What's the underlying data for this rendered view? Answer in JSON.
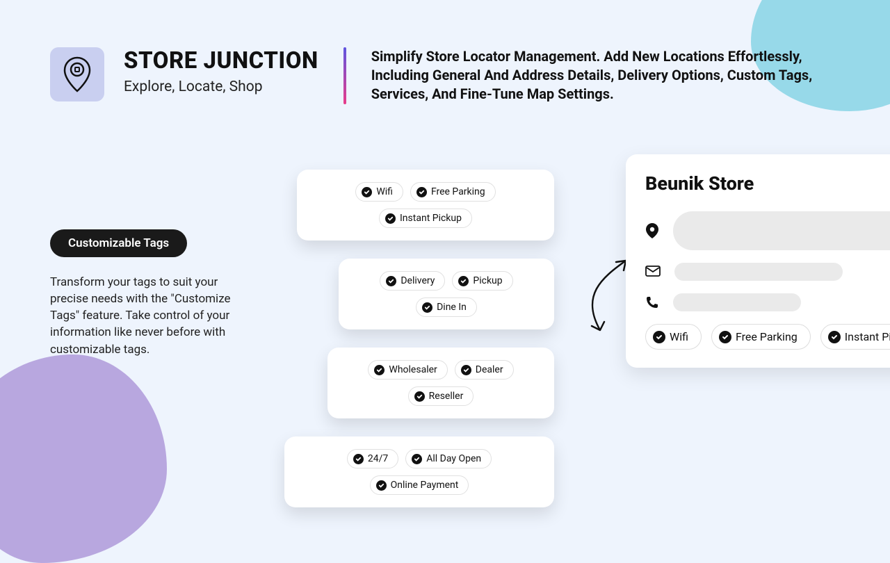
{
  "brand": {
    "title": "STORE JUNCTION",
    "tagline": "Explore, Locate, Shop",
    "description": "Simplify Store Locator Management. Add New Locations Effortlessly, Including General And Address Details, Delivery Options, Custom Tags, Services, And Fine-Tune Map Settings."
  },
  "feature": {
    "badge": "Customizable Tags",
    "description": "Transform your tags to suit your precise needs with the \"Customize Tags\" feature. Take control of your information like never before with customizable tags."
  },
  "tag_groups": [
    {
      "tags": [
        "Wifi",
        "Free Parking",
        "Instant Pickup"
      ]
    },
    {
      "tags": [
        "Delivery",
        "Pickup",
        "Dine In"
      ]
    },
    {
      "tags": [
        "Wholesaler",
        "Dealer",
        "Reseller"
      ]
    },
    {
      "tags": [
        "24/7",
        "All Day Open",
        "Online Payment"
      ]
    }
  ],
  "store_card": {
    "title": "Beunik Store",
    "tags": [
      "Wifi",
      "Free Parking",
      "Instant Pickup"
    ]
  }
}
